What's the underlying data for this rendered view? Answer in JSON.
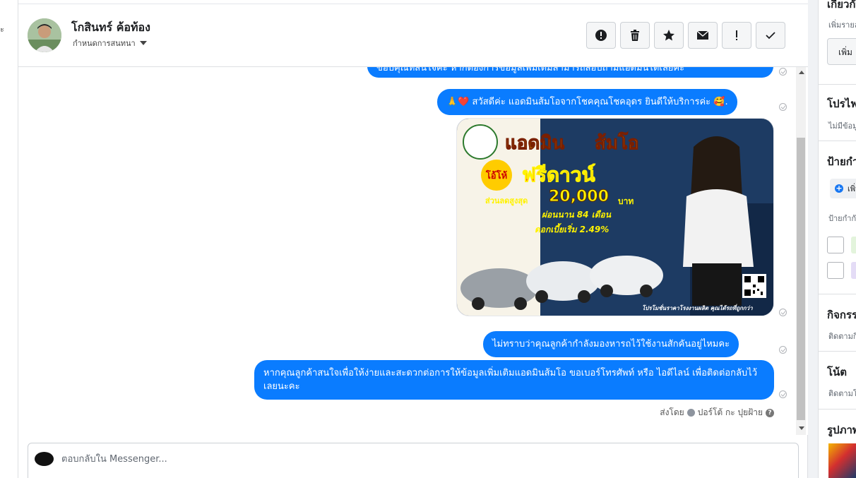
{
  "left_sidebar": {
    "glyph": "ะ"
  },
  "header": {
    "contact_name": "โกสินทร์ ค้อท้อง",
    "assign_label": "กำหนดการสนทนา"
  },
  "actions": [
    {
      "icon": "alert-circle-icon",
      "name": "spam"
    },
    {
      "icon": "trash-icon",
      "name": "delete"
    },
    {
      "icon": "star-icon",
      "name": "star"
    },
    {
      "icon": "envelope-icon",
      "name": "mark-unread"
    },
    {
      "icon": "exclamation-icon",
      "name": "follow-up"
    },
    {
      "icon": "check-icon",
      "name": "mark-done"
    }
  ],
  "messages": {
    "m0": "ขอบคุณที่สนใจค่ะ หากต้องการข้อมูลเพิ่มเติมสามารถสอบถามแอดมินได้เลยค่ะ",
    "m1": "🙏❤️ สวัสดีค่ะ แอดมินส้มโอจากโชคคุณโชคอุดร ยินดีให้บริการค่ะ 🥰.",
    "m2": "ไม่ทราบว่าคุณลูกค้ากำลังมองหารถไว้ใช้งานสักคันอยู่ไหมคะ",
    "m3": "หากคุณลูกค้าสนใจเพื่อให้ง่ายและสะดวกต่อการให้ข้อมูลเพิ่มเติมแอดมินส้มโอ ขอเบอร์โทรศัพท์ หรือ ไอดีไลน์ เพื่อติดต่อกลับไว้เลยนะคะ"
  },
  "promo": {
    "title_a": "แอดมิน",
    "title_b": "ส้มโอ",
    "badge": "โอ้โห้",
    "headline": "ฟรีดาวน์",
    "discount_label": "ส่วนลดสูงสุด",
    "discount_value": "20,000",
    "discount_unit": "บาท",
    "term": "ผ่อนนาน 84 เดือน",
    "rate": "ดอกเบี้ยเริ่ม 2.49%",
    "footer": "โปรโมชั่นราคาโรงงานผลิต คุณได้รถที่ถูกกว่า"
  },
  "sender": {
    "prefix": "ส่งโดย",
    "name": "ปอร์โต้ กะ ปุยฝ้าย",
    "help": "?"
  },
  "composer": {
    "placeholder": "ตอบกลับใน Messenger..."
  },
  "right_panel": {
    "about_title": "เกี่ยวกับ",
    "about_sub": "เพิ่มรายละเอียด",
    "about_btn": "เพิ่ม",
    "promo_title": "โปรไฟล์",
    "promo_sub": "ไม่มีข้อมูล",
    "tags_title": "ป้ายกำกับ",
    "tags_add": "เพิ่ม",
    "tags_sub": "ป้ายกำกับ",
    "activity_title": "กิจกรรม",
    "activity_sub": "ติดตามกิจกรรม",
    "notes_title": "โน้ต",
    "notes_sub": "ติดตามโน้ต",
    "media_title": "รูปภาพ"
  },
  "colors": {
    "bubble": "#0a7cff",
    "chip_green": "#e3f4dc",
    "chip_purple": "#e4dcf6"
  }
}
